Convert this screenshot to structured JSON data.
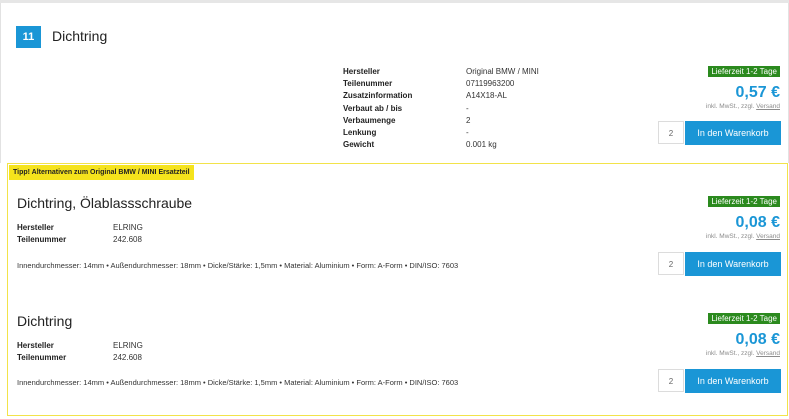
{
  "main": {
    "position": "11",
    "title": "Dichtring",
    "specs": [
      {
        "label": "Hersteller",
        "value": "Original BMW / MINI"
      },
      {
        "label": "Teilenummer",
        "value": "07119963200"
      },
      {
        "label": "Zusatzinformation",
        "value": "A14X18-AL"
      },
      {
        "label": "Verbaut ab / bis",
        "value": "-"
      },
      {
        "label": "Verbaumenge",
        "value": "2"
      },
      {
        "label": "Lenkung",
        "value": "-"
      },
      {
        "label": "Gewicht",
        "value": "0.001 kg"
      }
    ],
    "delivery": "Lieferzeit 1-2 Tage",
    "price": "0,57 €",
    "vat_prefix": "inkl. MwSt., zzgl.",
    "vat_link": "Versand",
    "qty": "2",
    "cart_label": "In den Warenkorb"
  },
  "tip_label": "Tipp! Alternativen zum Original BMW / MINI Ersatzteil",
  "alternatives": [
    {
      "title": "Dichtring, Ölablassschraube",
      "specs": [
        {
          "label": "Hersteller",
          "value": "ELRING"
        },
        {
          "label": "Teilenummer",
          "value": "242.608"
        }
      ],
      "description": "Innendurchmesser: 14mm • Außendurchmesser: 18mm • Dicke/Stärke: 1,5mm • Material: Aluminium • Form: A-Form • DIN/ISO: 7603",
      "delivery": "Lieferzeit 1-2 Tage",
      "price": "0,08 €",
      "vat_prefix": "inkl. MwSt., zzgl.",
      "vat_link": "Versand",
      "qty": "2",
      "cart_label": "In den Warenkorb"
    },
    {
      "title": "Dichtring",
      "specs": [
        {
          "label": "Hersteller",
          "value": "ELRING"
        },
        {
          "label": "Teilenummer",
          "value": "242.608"
        }
      ],
      "description": "Innendurchmesser: 14mm • Außendurchmesser: 18mm • Dicke/Stärke: 1,5mm • Material: Aluminium • Form: A-Form • DIN/ISO: 7603",
      "delivery": "Lieferzeit 1-2 Tage",
      "price": "0,08 €",
      "vat_prefix": "inkl. MwSt., zzgl.",
      "vat_link": "Versand",
      "qty": "2",
      "cart_label": "In den Warenkorb"
    }
  ],
  "colors": {
    "accent": "#1a96d6",
    "delivery": "#2b8a1e",
    "tip": "#f5e31c"
  }
}
